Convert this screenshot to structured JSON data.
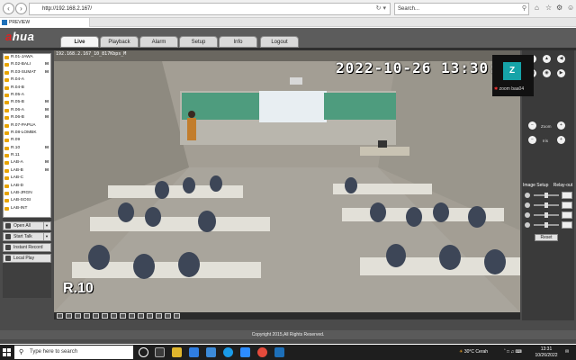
{
  "browser": {
    "url": "http://192.168.2.167/",
    "search_placeholder": "Search...",
    "tab_title": "PREVIEW"
  },
  "app": {
    "logo_a": "a",
    "logo_hua": "hua",
    "nav": [
      "Live",
      "Playback",
      "Alarm",
      "Setup",
      "Info",
      "Logout"
    ],
    "active_nav": "Live",
    "channels": [
      {
        "name": "R.01-JAWA",
        "m": ""
      },
      {
        "name": "R.02-BALI",
        "m": "M"
      },
      {
        "name": "R.03-SUMAT",
        "m": "M"
      },
      {
        "name": "R.04-A",
        "m": ""
      },
      {
        "name": "R.04-B",
        "m": ""
      },
      {
        "name": "R.05-A",
        "m": ""
      },
      {
        "name": "R.05-B",
        "m": "M"
      },
      {
        "name": "R.06-A",
        "m": "M"
      },
      {
        "name": "R.06-B",
        "m": "M"
      },
      {
        "name": "R.07-PAPUA",
        "m": ""
      },
      {
        "name": "R.08-LOMBK",
        "m": ""
      },
      {
        "name": "R.09",
        "m": ""
      },
      {
        "name": "R.10",
        "m": "M"
      },
      {
        "name": "R.11",
        "m": ""
      },
      {
        "name": "LAB-A",
        "m": "M"
      },
      {
        "name": "LAB-B",
        "m": "M"
      },
      {
        "name": "LAB-C",
        "m": ""
      },
      {
        "name": "LAB-D",
        "m": ""
      },
      {
        "name": "LAB-JRGN",
        "m": ""
      },
      {
        "name": "LAB-SOSI",
        "m": ""
      },
      {
        "name": "LAB-INT",
        "m": ""
      }
    ],
    "actions": [
      "Open All",
      "Start Talk",
      "Instant Record",
      "Local Play"
    ],
    "video": {
      "info": "192.168.2.167_10_817Kbps_M",
      "timestamp": "2022-10-26 13:30:06",
      "camera_label": "R.10"
    },
    "zoom_overlay": {
      "initial": "Z",
      "label": "zoom baa04"
    },
    "ptz_labels": {
      "zoom": "Zoom",
      "iris": "Iris"
    },
    "image_setup": {
      "title": "Image Setup",
      "rollout": "Relay-out",
      "reset": "Reset"
    },
    "footer": "Copyright 2015,All Rights Reserved."
  },
  "taskbar": {
    "search_placeholder": "Type here to search",
    "weather": "30°C  Cerah",
    "time": "13:31",
    "date": "10/26/2022"
  },
  "colors": {
    "accent_red": "#d22222",
    "camera_icon": "#e8a400",
    "zoom_tile": "#16a3a8"
  }
}
